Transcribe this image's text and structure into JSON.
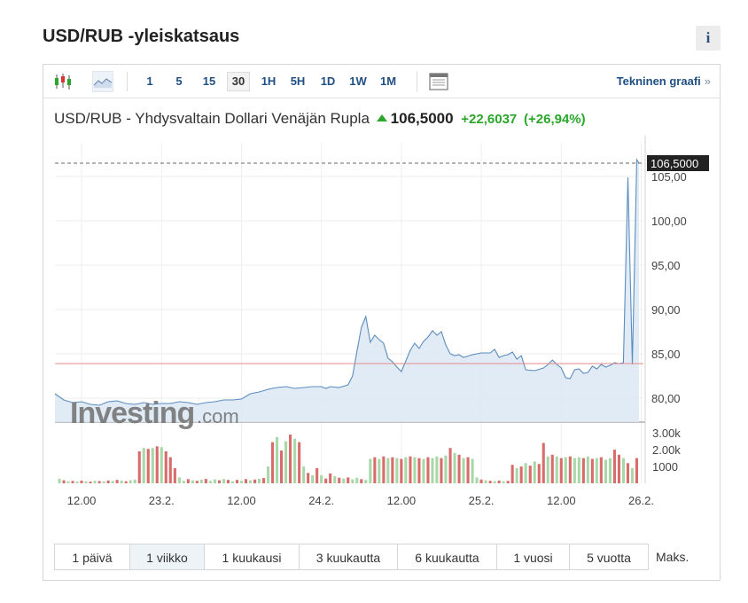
{
  "page": {
    "title": "USD/RUB -yleiskatsaus",
    "info_label": "i"
  },
  "toolbar": {
    "intervals": [
      "1",
      "5",
      "15",
      "30",
      "1H",
      "5H",
      "1D",
      "1W",
      "1M"
    ],
    "selected_interval": "30",
    "technical_link": "Tekninen graafi",
    "technical_link_arrow": "»"
  },
  "instrument": {
    "name": "USD/RUB - Yhdysvaltain Dollari Venäjän Rupla",
    "last": "106,5000",
    "change": "+22,6037",
    "change_pct": "(+26,94%)"
  },
  "watermark": {
    "brand": "Investing",
    "suffix": ".com"
  },
  "chart_data": {
    "type": "area",
    "price_axis": {
      "ticks": [
        "105,00",
        "100,00",
        "95,00",
        "90,00",
        "85,00",
        "80,00"
      ],
      "tick_values": [
        105,
        100,
        95,
        90,
        85,
        80
      ],
      "ylim": [
        77.3,
        108.6
      ]
    },
    "volume_axis": {
      "ticks": [
        "3.00k",
        "2.00k",
        "1000"
      ],
      "tick_values": [
        3000,
        2000,
        1000
      ],
      "ylim": [
        0,
        3800
      ]
    },
    "last_price_label": "106,5000",
    "last_price": 106.5,
    "reference_price": 83.9,
    "x_tick_labels": [
      "12.00",
      "23.2.",
      "12.00",
      "24.2.",
      "12.00",
      "25.2.",
      "12.00",
      "26.2."
    ],
    "x_tick_positions": [
      6,
      24,
      42,
      60,
      78,
      96,
      114,
      132
    ],
    "price": [
      [
        0,
        80.5
      ],
      [
        2,
        79.8
      ],
      [
        4,
        79.5
      ],
      [
        6,
        79.6
      ],
      [
        8,
        79.3
      ],
      [
        10,
        79.2
      ],
      [
        12,
        79.6
      ],
      [
        14,
        79.7
      ],
      [
        16,
        79.4
      ],
      [
        18,
        79.3
      ],
      [
        20,
        79.5
      ],
      [
        22,
        79.3
      ],
      [
        24,
        79.4
      ],
      [
        26,
        79.4
      ],
      [
        28,
        79.6
      ],
      [
        30,
        79.5
      ],
      [
        32,
        79.3
      ],
      [
        34,
        79.5
      ],
      [
        36,
        79.6
      ],
      [
        38,
        79.8
      ],
      [
        40,
        79.8
      ],
      [
        42,
        79.9
      ],
      [
        44,
        80.5
      ],
      [
        46,
        80.7
      ],
      [
        48,
        81.0
      ],
      [
        50,
        81.2
      ],
      [
        52,
        81.3
      ],
      [
        54,
        81.1
      ],
      [
        56,
        81.2
      ],
      [
        58,
        81.3
      ],
      [
        60,
        81.3
      ],
      [
        61,
        81.1
      ],
      [
        62,
        81.3
      ],
      [
        64,
        81.2
      ],
      [
        66,
        81.5
      ],
      [
        67,
        82.5
      ],
      [
        68,
        85.3
      ],
      [
        69,
        88.0
      ],
      [
        70,
        89.2
      ],
      [
        71,
        86.3
      ],
      [
        72,
        87.1
      ],
      [
        73,
        86.6
      ],
      [
        74,
        86.2
      ],
      [
        75,
        84.5
      ],
      [
        76,
        84.1
      ],
      [
        77,
        83.5
      ],
      [
        78,
        83.0
      ],
      [
        79,
        84.2
      ],
      [
        80,
        85.4
      ],
      [
        81,
        86.2
      ],
      [
        82,
        85.6
      ],
      [
        83,
        86.4
      ],
      [
        84,
        86.9
      ],
      [
        85,
        87.6
      ],
      [
        86,
        87.1
      ],
      [
        87,
        87.5
      ],
      [
        88,
        86.0
      ],
      [
        89,
        85.0
      ],
      [
        90,
        84.8
      ],
      [
        91,
        84.9
      ],
      [
        92,
        84.6
      ],
      [
        94,
        84.9
      ],
      [
        96,
        85.1
      ],
      [
        98,
        85.1
      ],
      [
        99,
        85.5
      ],
      [
        100,
        84.6
      ],
      [
        101,
        84.8
      ],
      [
        102,
        84.9
      ],
      [
        103,
        85.2
      ],
      [
        104,
        84.4
      ],
      [
        105,
        84.8
      ],
      [
        106,
        83.2
      ],
      [
        108,
        83.1
      ],
      [
        110,
        83.4
      ],
      [
        111,
        83.8
      ],
      [
        112,
        84.3
      ],
      [
        113,
        83.8
      ],
      [
        114,
        83.4
      ],
      [
        115,
        82.3
      ],
      [
        116,
        82.2
      ],
      [
        117,
        83.2
      ],
      [
        118,
        83.3
      ],
      [
        119,
        82.8
      ],
      [
        120,
        82.9
      ],
      [
        121,
        83.6
      ],
      [
        122,
        83.3
      ],
      [
        123,
        83.8
      ],
      [
        124,
        83.5
      ],
      [
        125,
        83.7
      ],
      [
        126,
        84.0
      ],
      [
        127,
        83.9
      ],
      [
        128,
        84.0
      ],
      [
        129,
        104.9
      ],
      [
        130,
        83.8
      ],
      [
        131,
        106.9
      ],
      [
        131.5,
        106.5
      ]
    ],
    "volume": [
      [
        1,
        270,
        "g"
      ],
      [
        2,
        180,
        "r"
      ],
      [
        3,
        120,
        "g"
      ],
      [
        4,
        140,
        "r"
      ],
      [
        5,
        100,
        "g"
      ],
      [
        6,
        160,
        "r"
      ],
      [
        7,
        120,
        "g"
      ],
      [
        8,
        100,
        "r"
      ],
      [
        9,
        150,
        "g"
      ],
      [
        10,
        130,
        "r"
      ],
      [
        11,
        110,
        "g"
      ],
      [
        12,
        170,
        "r"
      ],
      [
        13,
        140,
        "g"
      ],
      [
        14,
        200,
        "r"
      ],
      [
        15,
        160,
        "g"
      ],
      [
        16,
        120,
        "r"
      ],
      [
        17,
        180,
        "g"
      ],
      [
        18,
        220,
        "g"
      ],
      [
        19,
        1900,
        "r"
      ],
      [
        20,
        2100,
        "g"
      ],
      [
        21,
        2050,
        "r"
      ],
      [
        22,
        2100,
        "g"
      ],
      [
        23,
        2200,
        "r"
      ],
      [
        24,
        2150,
        "g"
      ],
      [
        25,
        1900,
        "r"
      ],
      [
        26,
        1550,
        "r"
      ],
      [
        27,
        900,
        "r"
      ],
      [
        28,
        350,
        "g"
      ],
      [
        29,
        150,
        "g"
      ],
      [
        30,
        250,
        "r"
      ],
      [
        31,
        180,
        "g"
      ],
      [
        32,
        150,
        "r"
      ],
      [
        33,
        210,
        "g"
      ],
      [
        34,
        260,
        "r"
      ],
      [
        35,
        150,
        "g"
      ],
      [
        36,
        230,
        "g"
      ],
      [
        37,
        180,
        "r"
      ],
      [
        38,
        260,
        "g"
      ],
      [
        39,
        200,
        "r"
      ],
      [
        40,
        120,
        "g"
      ],
      [
        41,
        200,
        "r"
      ],
      [
        42,
        150,
        "g"
      ],
      [
        43,
        250,
        "r"
      ],
      [
        44,
        180,
        "g"
      ],
      [
        45,
        220,
        "r"
      ],
      [
        46,
        260,
        "g"
      ],
      [
        47,
        310,
        "r"
      ],
      [
        48,
        1000,
        "g"
      ],
      [
        49,
        2450,
        "r"
      ],
      [
        50,
        2750,
        "g"
      ],
      [
        51,
        1950,
        "r"
      ],
      [
        52,
        2500,
        "g"
      ],
      [
        53,
        2900,
        "r"
      ],
      [
        54,
        2650,
        "g"
      ],
      [
        55,
        2450,
        "r"
      ],
      [
        56,
        1000,
        "g"
      ],
      [
        57,
        620,
        "r"
      ],
      [
        58,
        480,
        "g"
      ],
      [
        59,
        900,
        "r"
      ],
      [
        60,
        480,
        "g"
      ],
      [
        61,
        280,
        "r"
      ],
      [
        62,
        580,
        "r"
      ],
      [
        63,
        420,
        "g"
      ],
      [
        64,
        330,
        "r"
      ],
      [
        65,
        280,
        "g"
      ],
      [
        66,
        350,
        "r"
      ],
      [
        67,
        240,
        "g"
      ],
      [
        68,
        320,
        "g"
      ],
      [
        69,
        250,
        "r"
      ],
      [
        70,
        200,
        "g"
      ],
      [
        71,
        1450,
        "g"
      ],
      [
        72,
        1550,
        "r"
      ],
      [
        73,
        1450,
        "g"
      ],
      [
        74,
        1600,
        "r"
      ],
      [
        75,
        1500,
        "g"
      ],
      [
        76,
        1550,
        "r"
      ],
      [
        77,
        1500,
        "g"
      ],
      [
        78,
        1450,
        "r"
      ],
      [
        79,
        1550,
        "g"
      ],
      [
        80,
        1600,
        "r"
      ],
      [
        81,
        1550,
        "g"
      ],
      [
        82,
        1500,
        "r"
      ],
      [
        83,
        1450,
        "g"
      ],
      [
        84,
        1550,
        "r"
      ],
      [
        85,
        1500,
        "g"
      ],
      [
        86,
        1600,
        "g"
      ],
      [
        87,
        1500,
        "r"
      ],
      [
        88,
        1650,
        "g"
      ],
      [
        89,
        2100,
        "r"
      ],
      [
        90,
        1800,
        "g"
      ],
      [
        91,
        1700,
        "r"
      ],
      [
        92,
        1500,
        "g"
      ],
      [
        93,
        1550,
        "r"
      ],
      [
        94,
        1450,
        "g"
      ],
      [
        95,
        350,
        "g"
      ],
      [
        96,
        220,
        "r"
      ],
      [
        97,
        180,
        "g"
      ],
      [
        98,
        150,
        "r"
      ],
      [
        99,
        130,
        "g"
      ],
      [
        100,
        160,
        "r"
      ],
      [
        101,
        120,
        "g"
      ],
      [
        102,
        140,
        "r"
      ],
      [
        103,
        1100,
        "r"
      ],
      [
        104,
        900,
        "g"
      ],
      [
        105,
        1000,
        "r"
      ],
      [
        106,
        1200,
        "g"
      ],
      [
        107,
        1050,
        "r"
      ],
      [
        108,
        1300,
        "g"
      ],
      [
        109,
        1150,
        "r"
      ],
      [
        110,
        2400,
        "r"
      ],
      [
        111,
        1600,
        "g"
      ],
      [
        112,
        1700,
        "r"
      ],
      [
        113,
        1600,
        "g"
      ],
      [
        114,
        1500,
        "r"
      ],
      [
        115,
        1550,
        "g"
      ],
      [
        116,
        1600,
        "r"
      ],
      [
        117,
        1500,
        "g"
      ],
      [
        118,
        1550,
        "g"
      ],
      [
        119,
        1500,
        "r"
      ],
      [
        120,
        1600,
        "g"
      ],
      [
        121,
        1450,
        "r"
      ],
      [
        122,
        1500,
        "g"
      ],
      [
        123,
        1550,
        "r"
      ],
      [
        124,
        1400,
        "g"
      ],
      [
        125,
        1500,
        "g"
      ],
      [
        126,
        2000,
        "r"
      ],
      [
        127,
        1700,
        "r"
      ],
      [
        128,
        1500,
        "g"
      ],
      [
        129,
        1200,
        "r"
      ],
      [
        130,
        900,
        "g"
      ],
      [
        131,
        1500,
        "r"
      ]
    ]
  },
  "ranges": {
    "buttons": [
      "1 päivä",
      "1 viikko",
      "1 kuukausi",
      "3 kuukautta",
      "6 kuukautta",
      "1 vuosi",
      "5 vuotta"
    ],
    "selected": "1 viikko",
    "max_label": "Maks."
  }
}
